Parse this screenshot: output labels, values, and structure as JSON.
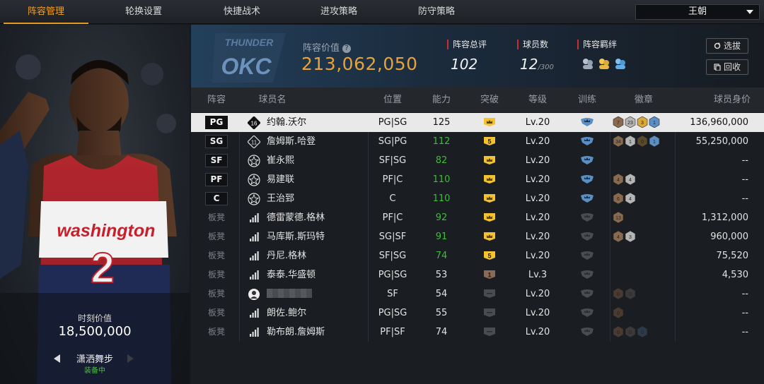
{
  "tabs": [
    {
      "label": "阵容管理",
      "active": true
    },
    {
      "label": "轮换设置",
      "active": false
    },
    {
      "label": "快捷战术",
      "active": false
    },
    {
      "label": "进攻策略",
      "active": false
    },
    {
      "label": "防守策略",
      "active": false
    }
  ],
  "team_select": {
    "value": "王朝"
  },
  "left_panel": {
    "jersey_text": "washington",
    "jersey_number": "2",
    "moment_label": "时刻价值",
    "moment_value": "18,500,000",
    "skill_name": "潇洒舞步",
    "skill_state": "装备中"
  },
  "header": {
    "logo_text": "OKC",
    "logo_top": "THUNDER",
    "value_label": "阵容价值",
    "help_icon": "?",
    "value": "213,062,050",
    "rating_label": "阵容总评",
    "rating": "102",
    "count_label": "球员数",
    "count": "12",
    "count_max": "/300",
    "bond_label": "阵容羁绊",
    "btn_select": "选拔",
    "btn_recycle": "回收"
  },
  "columns": [
    "阵容",
    "球员名",
    "位置",
    "能力",
    "突破",
    "等级",
    "训练",
    "徽章",
    "球员身价"
  ],
  "rows": [
    {
      "slot": "PG",
      "starter": true,
      "icon": "jersey-16",
      "name": "约翰.沃尔",
      "pos": "PG|SG",
      "ability": "125",
      "green": false,
      "breakthrough": "crown",
      "level": "Lv.20",
      "training": "blue",
      "badges": [
        [
          "7",
          "#8a6a4e"
        ],
        [
          "23",
          "#b5b5b5"
        ],
        [
          "3",
          "#d9a93c"
        ],
        [
          "1",
          "#5b8fc4"
        ]
      ],
      "price": "136,960,000"
    },
    {
      "slot": "SG",
      "starter": true,
      "icon": "jersey-11",
      "name": "詹姆斯.哈登",
      "pos": "SG|PG",
      "ability": "112",
      "green": true,
      "breakthrough": "5",
      "level": "Lv.20",
      "training": "blue",
      "badges": [
        [
          "34",
          "#8a6a4e"
        ],
        [
          "1",
          "#b5b5b5"
        ],
        [
          "0",
          "#5a4a2a"
        ],
        [
          "1",
          "#5b8fc4"
        ]
      ],
      "price": "55,250,000"
    },
    {
      "slot": "SF",
      "starter": true,
      "icon": "star",
      "name": "崔永熙",
      "pos": "SF|SG",
      "ability": "82",
      "green": true,
      "breakthrough": "crown",
      "level": "Lv.20",
      "training": "blue",
      "badges": [],
      "price": "--"
    },
    {
      "slot": "PF",
      "starter": true,
      "icon": "star",
      "name": "易建联",
      "pos": "PF|C",
      "ability": "110",
      "green": true,
      "breakthrough": "crown",
      "level": "Lv.20",
      "training": "blue",
      "badges": [
        [
          "4",
          "#8a6a4e"
        ],
        [
          "4",
          "#b5b5b5"
        ]
      ],
      "price": "--"
    },
    {
      "slot": "C",
      "starter": true,
      "icon": "star",
      "name": "王治郅",
      "pos": "C",
      "ability": "110",
      "green": true,
      "breakthrough": "crown",
      "level": "Lv.20",
      "training": "blue",
      "badges": [
        [
          "6",
          "#8a6a4e"
        ],
        [
          "4",
          "#b5b5b5"
        ]
      ],
      "price": "--"
    },
    {
      "slot": "板凳",
      "starter": false,
      "icon": "bars",
      "name": "德雷蒙德.格林",
      "pos": "PF|C",
      "ability": "92",
      "green": true,
      "breakthrough": "crown",
      "level": "Lv.20",
      "training": "grey",
      "badges": [
        [
          "13",
          "#8a6a4e"
        ]
      ],
      "price": "1,312,000"
    },
    {
      "slot": "板凳",
      "starter": false,
      "icon": "bars",
      "name": "马库斯.斯玛特",
      "pos": "SG|SF",
      "ability": "91",
      "green": true,
      "breakthrough": "crown",
      "level": "Lv.20",
      "training": "grey",
      "badges": [
        [
          "4",
          "#8a6a4e"
        ],
        [
          "3",
          "#b5b5b5"
        ]
      ],
      "price": "960,000"
    },
    {
      "slot": "板凳",
      "starter": false,
      "icon": "bars",
      "name": "丹尼.格林",
      "pos": "SF|SG",
      "ability": "74",
      "green": true,
      "breakthrough": "5",
      "level": "Lv.20",
      "training": "grey",
      "badges": [],
      "price": "75,520"
    },
    {
      "slot": "板凳",
      "starter": false,
      "icon": "bars",
      "name": "泰泰.华盛顿",
      "pos": "PG|SG",
      "ability": "53",
      "green": false,
      "breakthrough": "1",
      "level": "Lv.3",
      "training": "grey",
      "badges": [],
      "price": "4,530"
    },
    {
      "slot": "板凳",
      "starter": false,
      "icon": "person",
      "name": "",
      "masked": true,
      "pos": "SF",
      "ability": "54",
      "green": false,
      "breakthrough": "none",
      "level": "Lv.20",
      "training": "grey",
      "badges": [
        [
          "0",
          "#4a3a30"
        ],
        [
          "0",
          "#3a3a3a"
        ]
      ],
      "price": "--"
    },
    {
      "slot": "板凳",
      "starter": false,
      "icon": "bars",
      "name": "朗佐.鲍尔",
      "pos": "PG|SG",
      "ability": "55",
      "green": false,
      "breakthrough": "none",
      "level": "Lv.20",
      "training": "grey",
      "badges": [
        [
          "0",
          "#4a3a30"
        ]
      ],
      "price": "--"
    },
    {
      "slot": "板凳",
      "starter": false,
      "icon": "bars",
      "name": "勒布朗.詹姆斯",
      "pos": "PF|SF",
      "ability": "74",
      "green": false,
      "breakthrough": "none",
      "level": "Lv.20",
      "training": "grey",
      "badges": [
        [
          "0",
          "#4a3a30"
        ],
        [
          "0",
          "#3a3a3a"
        ],
        [
          "0",
          "#2c3a4a"
        ]
      ],
      "price": "--"
    }
  ],
  "colors": {
    "accent": "#e59a1f",
    "green": "#3dbd3a",
    "gold": "#e6a33a"
  }
}
